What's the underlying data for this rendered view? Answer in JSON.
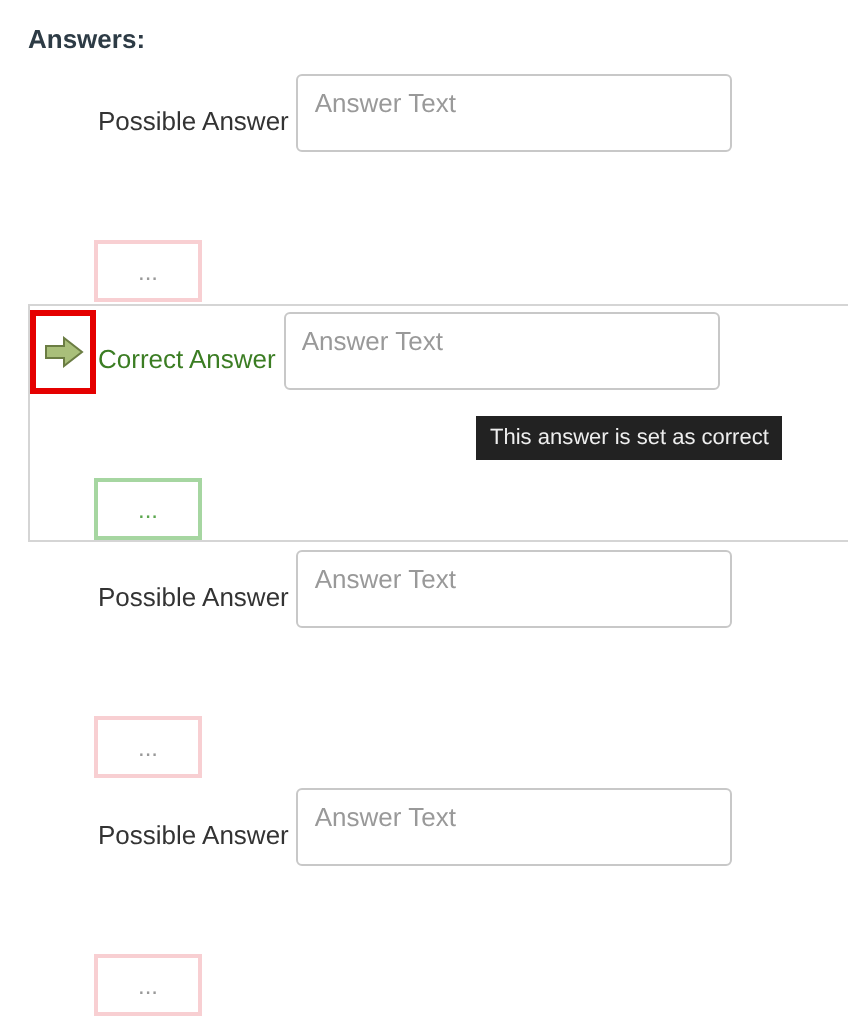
{
  "heading": "Answers:",
  "answers": [
    {
      "label": "Possible Answer",
      "placeholder": "Answer Text",
      "correct": false,
      "more": "..."
    },
    {
      "label": "Correct Answer",
      "placeholder": "Answer Text",
      "correct": true,
      "tooltip": "This answer is set as correct",
      "more": "..."
    },
    {
      "label": "Possible Answer",
      "placeholder": "Answer Text",
      "correct": false,
      "more": "..."
    },
    {
      "label": "Possible Answer",
      "placeholder": "Answer Text",
      "correct": false,
      "more": "..."
    }
  ]
}
